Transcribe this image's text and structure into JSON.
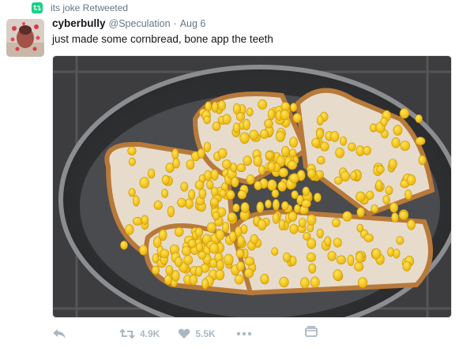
{
  "retweet_context": {
    "text": "its joke Retweeted",
    "icon": "retweet-badge-icon"
  },
  "tweet": {
    "display_name": "cyberbully",
    "handle": "@Speculation",
    "separator": "·",
    "date": "Aug 6",
    "text": "just made some cornbread, bone app the teeth",
    "media_alt_icon": "photo-of-corn-on-bread-in-pan"
  },
  "actions": {
    "reply_icon": "reply-icon",
    "retweet_icon": "retweet-icon",
    "retweet_count": "4.9K",
    "like_icon": "heart-icon",
    "like_count": "5.5K",
    "more_icon": "more-dots-icon",
    "dm_icon": "direct-message-icon"
  },
  "colors": {
    "accent_retweet": "#19cf86",
    "muted": "#657786",
    "icon_gray": "#aab8c2",
    "text": "#14171a"
  }
}
